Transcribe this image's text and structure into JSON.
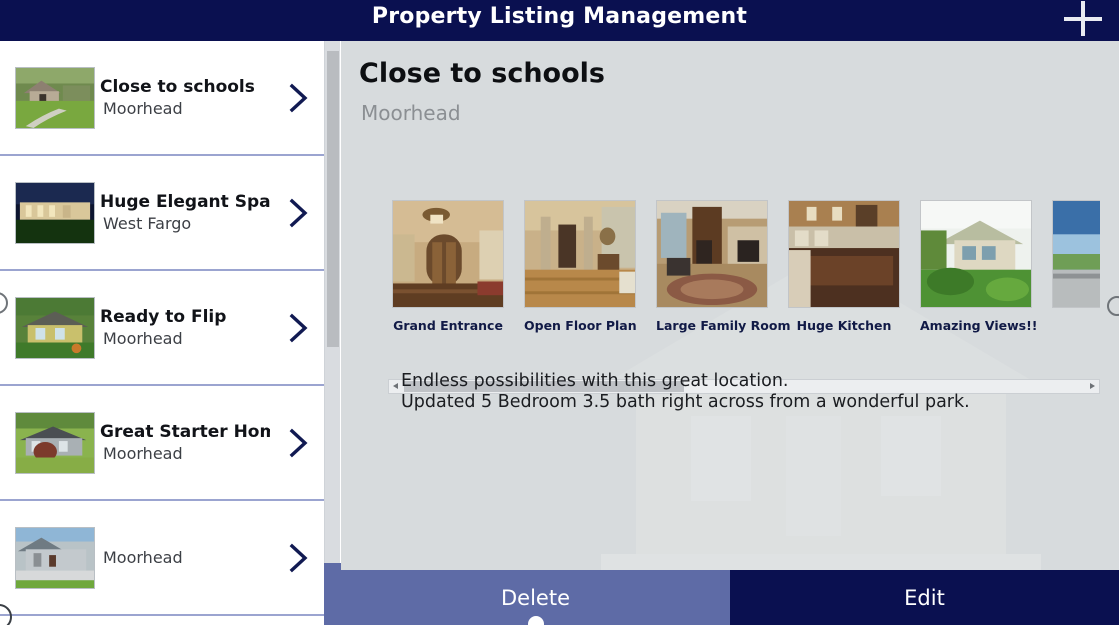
{
  "window": {
    "title": "Property Listing Management",
    "add_icon": "plus-icon"
  },
  "sidebar": {
    "items": [
      {
        "title": "Close to schools",
        "subtitle": "Moorhead",
        "chevron": "chevron-right-icon"
      },
      {
        "title": "Huge Elegant Space",
        "subtitle": "West Fargo",
        "chevron": "chevron-right-icon"
      },
      {
        "title": "Ready to Flip",
        "subtitle": "Moorhead",
        "chevron": "chevron-right-icon"
      },
      {
        "title": "Great Starter Home",
        "subtitle": "Moorhead",
        "chevron": "chevron-right-icon"
      },
      {
        "title": "",
        "subtitle": "Moorhead",
        "chevron": "chevron-right-icon"
      }
    ],
    "scroll_down_icon": "triangle-down-icon"
  },
  "detail": {
    "title": "Close to schools",
    "subtitle": "Moorhead",
    "description": "Endless possibilities with this great location.\nUpdated 5 Bedroom 3.5 bath right across from a wonderful park.",
    "photos": [
      {
        "caption": "Grand Entrance"
      },
      {
        "caption": "Open Floor Plan"
      },
      {
        "caption": "Large Family Room"
      },
      {
        "caption": "Huge Kitchen"
      },
      {
        "caption": "Amazing Views!!"
      },
      {
        "caption": ""
      }
    ],
    "scrollbar": {
      "left_arrow_icon": "triangle-left-icon",
      "right_arrow_icon": "triangle-right-icon"
    }
  },
  "actions": {
    "delete_label": "Delete",
    "edit_label": "Edit"
  },
  "colors": {
    "titlebar": "#0a1050",
    "accent_navy": "#0a1050",
    "delete_button": "#5e6ba6",
    "panel_background": "#d7dbdd",
    "separator": "#9ba4d0"
  }
}
